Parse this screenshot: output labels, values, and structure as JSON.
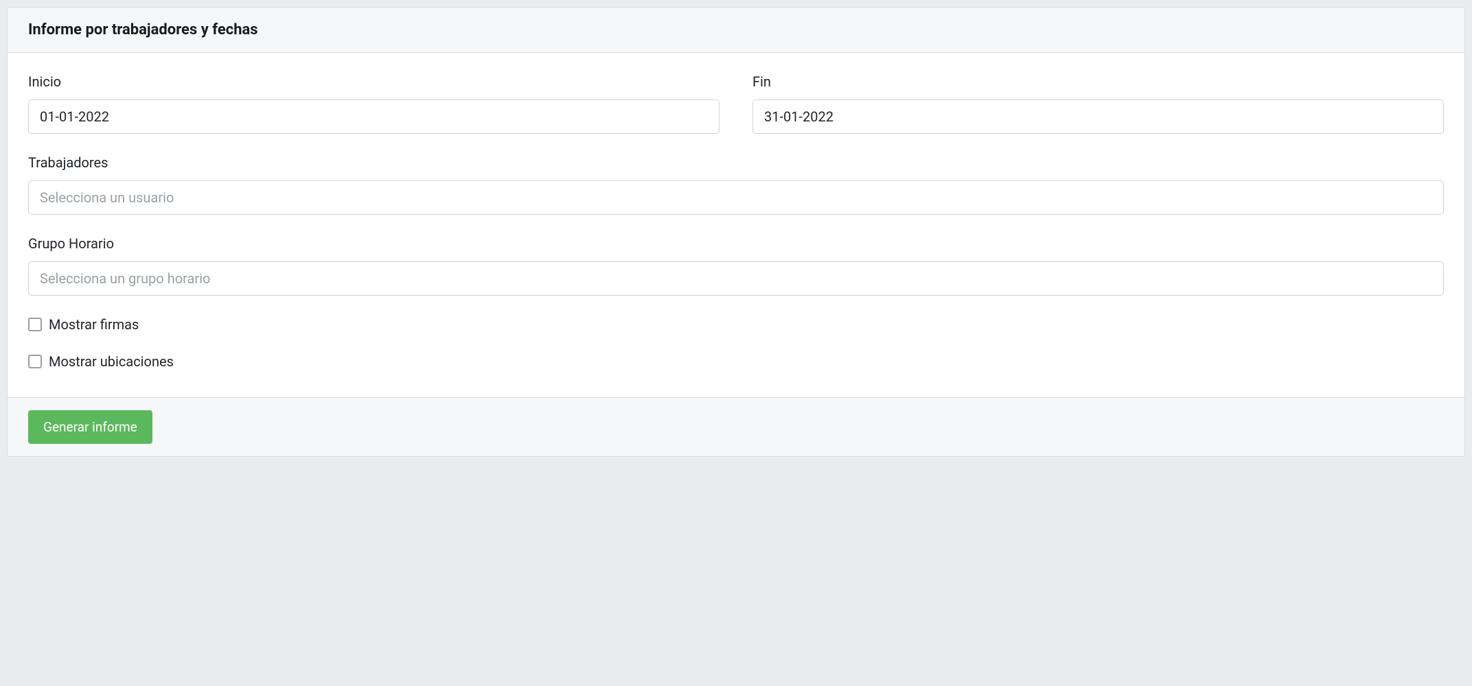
{
  "header": {
    "title": "Informe por trabajadores y fechas"
  },
  "form": {
    "inicio": {
      "label": "Inicio",
      "value": "01-01-2022"
    },
    "fin": {
      "label": "Fin",
      "value": "31-01-2022"
    },
    "trabajadores": {
      "label": "Trabajadores",
      "placeholder": "Selecciona un usuario"
    },
    "grupo_horario": {
      "label": "Grupo Horario",
      "placeholder": "Selecciona un grupo horario"
    },
    "mostrar_firmas": {
      "label": "Mostrar firmas",
      "checked": false
    },
    "mostrar_ubicaciones": {
      "label": "Mostrar ubicaciones",
      "checked": false
    }
  },
  "footer": {
    "submit_label": "Generar informe"
  }
}
